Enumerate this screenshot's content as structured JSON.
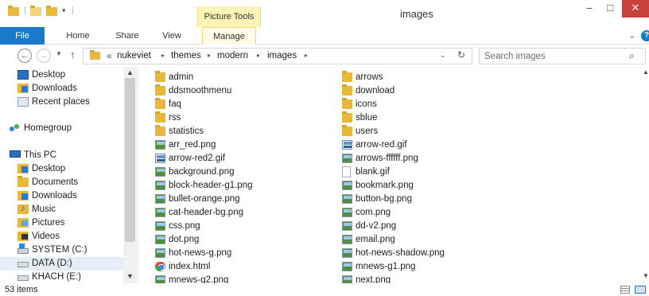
{
  "window": {
    "title": "images",
    "context_tab_group": "Picture Tools",
    "controls": {
      "minimize": "–",
      "maximize": "□",
      "close": "✕"
    }
  },
  "ribbon": {
    "tabs": [
      "File",
      "Home",
      "Share",
      "View",
      "Manage"
    ],
    "expand": "⌄",
    "help": "?"
  },
  "address": {
    "back": "←",
    "forward": "→",
    "up": "↑",
    "overflow": "«",
    "breadcrumb": [
      "nukeviet",
      "themes",
      "modern",
      "images"
    ],
    "separator": "▸",
    "dropdown": "⌄",
    "refresh": "↻"
  },
  "search": {
    "placeholder": "Search images",
    "icon": "search-icon"
  },
  "nav_pane": {
    "items": [
      {
        "label": "Desktop",
        "icon": "desktop-icon"
      },
      {
        "label": "Downloads",
        "icon": "downloads-icon"
      },
      {
        "label": "Recent places",
        "icon": "recent-places-icon"
      },
      {
        "label": "Homegroup",
        "icon": "homegroup-icon"
      },
      {
        "label": "This PC",
        "icon": "this-pc-icon"
      },
      {
        "label": "Desktop",
        "icon": "desktop-folder-icon"
      },
      {
        "label": "Documents",
        "icon": "documents-icon"
      },
      {
        "label": "Downloads",
        "icon": "downloads-icon"
      },
      {
        "label": "Music",
        "icon": "music-icon"
      },
      {
        "label": "Pictures",
        "icon": "pictures-icon"
      },
      {
        "label": "Videos",
        "icon": "videos-icon"
      },
      {
        "label": "SYSTEM (C:)",
        "icon": "system-drive-icon"
      },
      {
        "label": "DATA (D:)",
        "icon": "drive-icon",
        "selected": true
      },
      {
        "label": "KHACH (E:)",
        "icon": "drive-icon"
      }
    ]
  },
  "files": {
    "left": [
      {
        "name": "admin",
        "type": "folder"
      },
      {
        "name": "ddsmoothmenu",
        "type": "folder"
      },
      {
        "name": "faq",
        "type": "folder"
      },
      {
        "name": "rss",
        "type": "folder"
      },
      {
        "name": "statistics",
        "type": "folder"
      },
      {
        "name": "arr_red.png",
        "type": "png"
      },
      {
        "name": "arrow-red2.gif",
        "type": "gif"
      },
      {
        "name": "background.png",
        "type": "png"
      },
      {
        "name": "block-header-g1.png",
        "type": "png"
      },
      {
        "name": "bullet-orange.png",
        "type": "png"
      },
      {
        "name": "cat-header-bg.png",
        "type": "png"
      },
      {
        "name": "css.png",
        "type": "png"
      },
      {
        "name": "dot.png",
        "type": "png"
      },
      {
        "name": "hot-news-g.png",
        "type": "png"
      },
      {
        "name": "index.html",
        "type": "html"
      },
      {
        "name": "mnews-g2.png",
        "type": "png"
      }
    ],
    "right": [
      {
        "name": "arrows",
        "type": "folder"
      },
      {
        "name": "download",
        "type": "folder"
      },
      {
        "name": "icons",
        "type": "folder"
      },
      {
        "name": "sblue",
        "type": "folder"
      },
      {
        "name": "users",
        "type": "folder"
      },
      {
        "name": "arrow-red.gif",
        "type": "gif"
      },
      {
        "name": "arrows-ffffff.png",
        "type": "png"
      },
      {
        "name": "blank.gif",
        "type": "blank"
      },
      {
        "name": "bookmark.png",
        "type": "png"
      },
      {
        "name": "button-bg.png",
        "type": "png"
      },
      {
        "name": "com.png",
        "type": "png"
      },
      {
        "name": "dd-v2.png",
        "type": "png"
      },
      {
        "name": "email.png",
        "type": "png"
      },
      {
        "name": "hot-news-shadow.png",
        "type": "png"
      },
      {
        "name": "mnews-g1.png",
        "type": "png"
      },
      {
        "name": "next.png",
        "type": "png"
      }
    ]
  },
  "status": {
    "item_count": "53 items"
  },
  "colors": {
    "accent": "#1979ca",
    "close": "#c7423b",
    "picture_tools": "#fdf3b4"
  }
}
